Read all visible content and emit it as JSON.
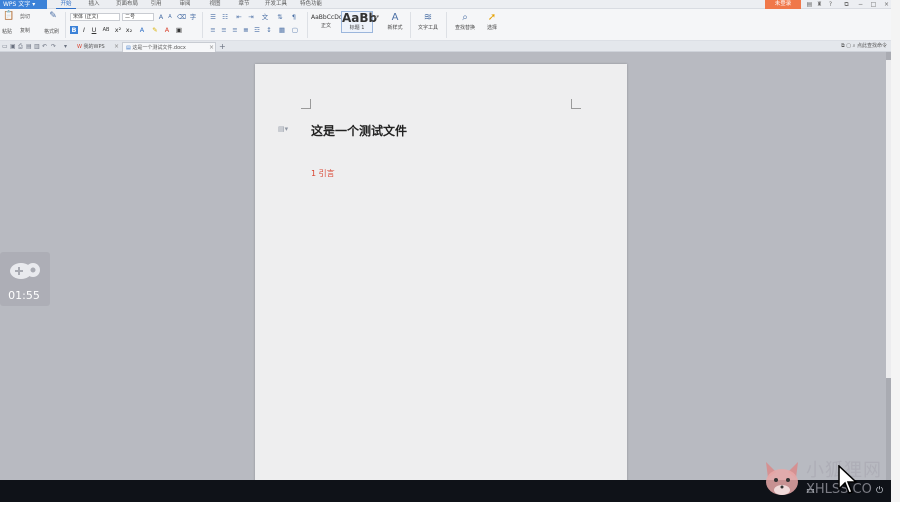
{
  "app": {
    "name": "WPS 文字"
  },
  "menu": {
    "tabs": [
      "开始",
      "插入",
      "页面布局",
      "引用",
      "审阅",
      "视图",
      "章节",
      "开发工具",
      "特色功能"
    ],
    "login_label": "未登录",
    "window_controls": [
      "−",
      "□",
      "×"
    ]
  },
  "ribbon": {
    "clipboard": {
      "paste": "粘贴",
      "cut": "剪切",
      "copy": "复制",
      "format_painter": "格式刷"
    },
    "font_name": "宋体 (正文)",
    "font_size": "二号",
    "styles": [
      {
        "preview": "AaBbCcDd",
        "name": "正文"
      },
      {
        "preview": "AaBb",
        "name": "标题 1"
      }
    ],
    "new_style_label": "新样式",
    "text_tools_label": "文字工具",
    "find_replace_label": "查找替换",
    "select_label": "选择"
  },
  "doc_tabs": {
    "home_tab": "我的WPS",
    "active_tab": "这是一个测试文件.docx",
    "new_tab": "+",
    "right_hint": "点此查找命令"
  },
  "document": {
    "title": "这是一个测试文件",
    "heading1": "1  引言"
  },
  "overlay": {
    "time": "01:55"
  },
  "watermark": {
    "text": "小狐狸网",
    "domain": "XHLSS.CO"
  },
  "colors": {
    "accent": "#3c82d8",
    "login": "#f0784a",
    "heading": "#d9432f",
    "taskbar": "#0f1218"
  }
}
